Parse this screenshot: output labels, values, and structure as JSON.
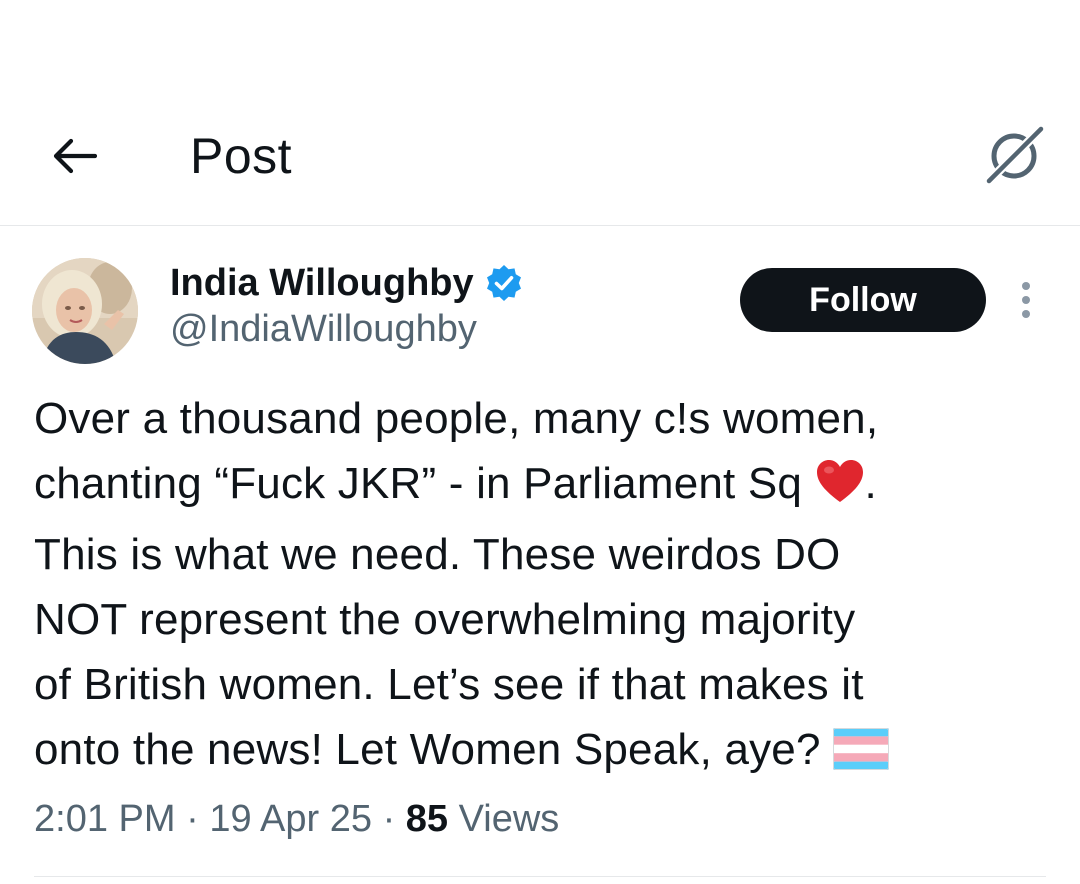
{
  "header": {
    "title": "Post",
    "back_icon": "arrow-left-icon",
    "grok_icon": "grok-icon"
  },
  "author": {
    "display_name": "India Willoughby",
    "handle": "@IndiaWilloughby",
    "verified": true,
    "verified_color": "#1d9bf0",
    "follow_label": "Follow"
  },
  "tweet": {
    "lines": [
      "Over a thousand people, many c!s women,",
      "chanting “Fuck JKR” - in Parliament Sq",
      ".",
      "This is what we need. These weirdos DO",
      "NOT represent the overwhelming majority",
      "of British women. Let’s see if that makes it",
      "onto the news! Let Women Speak, aye?"
    ],
    "emojis": [
      "red-heart-icon",
      "transgender-flag-icon"
    ]
  },
  "meta": {
    "time": "2:01 PM",
    "separator": "·",
    "date": "19 Apr 25",
    "views_count": "85",
    "views_label": "Views"
  },
  "colors": {
    "text": "#0f1419",
    "secondary": "#536471",
    "follow_bg": "#0f1419",
    "heart": "#e0262e"
  }
}
